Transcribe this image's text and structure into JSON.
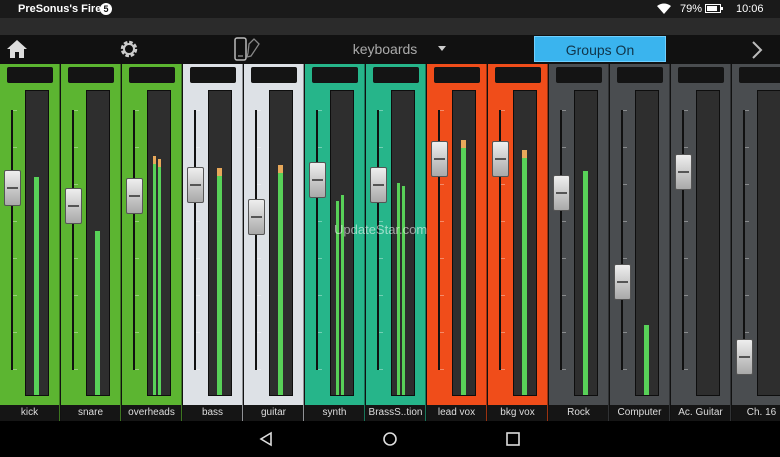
{
  "status_bar": {
    "app_name": "PreSonus's Fire",
    "notification_count": "5",
    "battery": "79%",
    "time": "10:06"
  },
  "toolbar": {
    "scene_name": "keyboards",
    "groups_button": "Groups On",
    "icons": [
      "home-icon",
      "gear-icon",
      "phone-sync-icon",
      "chevron-down-icon",
      "chevron-right-icon"
    ]
  },
  "watermark": "UpdateStar.com",
  "colors": {
    "green": "#5cb531",
    "white": "#dde1e6",
    "teal": "#26b58a",
    "orange": "#f04d1a",
    "gray": "#4a4d50",
    "meter": "#58d158",
    "peak": "#e7a85a",
    "groups": "#3ab4ee"
  },
  "channels": [
    {
      "label": "kick",
      "color": "green",
      "fader": 0.7,
      "meter": [
        0.72
      ]
    },
    {
      "label": "snare",
      "color": "green",
      "fader": 0.63,
      "meter": [
        0.54
      ]
    },
    {
      "label": "overheads",
      "color": "green",
      "fader": 0.67,
      "meter": [
        0.79,
        0.78
      ]
    },
    {
      "label": "bass",
      "color": "white",
      "fader": 0.71,
      "meter": [
        0.75
      ]
    },
    {
      "label": "guitar",
      "color": "white",
      "fader": 0.59,
      "meter": [
        0.76
      ]
    },
    {
      "label": "synth",
      "color": "teal",
      "fader": 0.73,
      "meter": [
        0.64,
        0.66
      ]
    },
    {
      "label": "BrassS..tion",
      "color": "teal",
      "fader": 0.71,
      "meter": [
        0.7,
        0.69
      ]
    },
    {
      "label": "lead vox",
      "color": "orange",
      "fader": 0.81,
      "meter": [
        0.84
      ]
    },
    {
      "label": "bkg vox",
      "color": "orange",
      "fader": 0.81,
      "meter": [
        0.81
      ]
    },
    {
      "label": "Rock",
      "color": "gray",
      "fader": 0.68,
      "meter": [
        0.74
      ]
    },
    {
      "label": "Computer",
      "color": "gray",
      "fader": 0.34,
      "meter": [
        0.23
      ]
    },
    {
      "label": "Ac. Guitar",
      "color": "gray",
      "fader": 0.76,
      "meter": []
    },
    {
      "label": "Ch. 16",
      "color": "gray",
      "fader": 0.05,
      "meter": []
    }
  ],
  "nav": {
    "icons": [
      "back-icon",
      "home-circle-icon",
      "recents-icon"
    ]
  }
}
